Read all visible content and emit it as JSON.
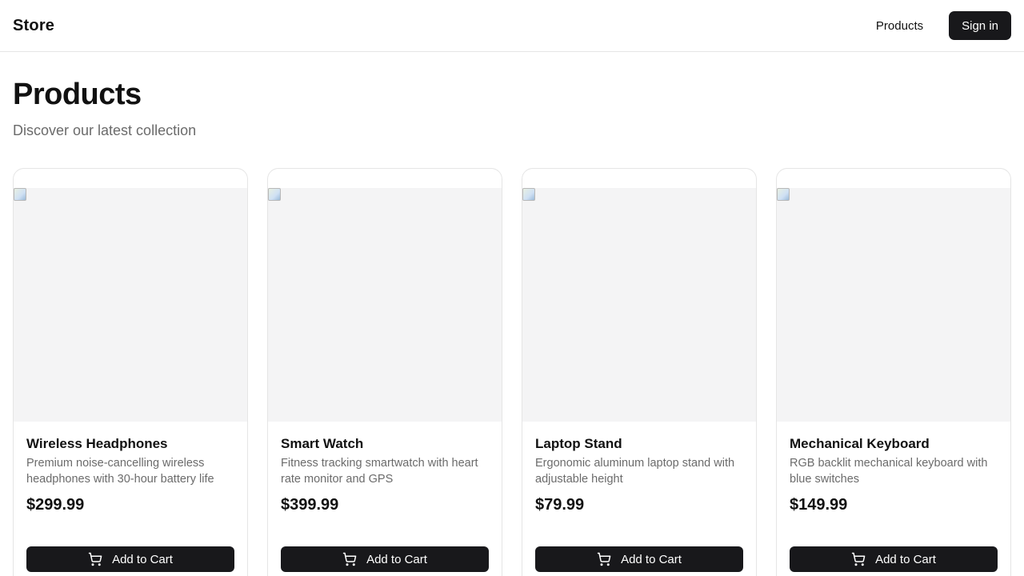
{
  "header": {
    "brand": "Store",
    "nav_products": "Products",
    "signin": "Sign in"
  },
  "page": {
    "title": "Products",
    "subtitle": "Discover our latest collection"
  },
  "products": [
    {
      "name": "Wireless Headphones",
      "description": "Premium noise-cancelling wireless headphones with 30-hour battery life",
      "price": "$299.99",
      "button": "Add to Cart",
      "icon": "cart-icon"
    },
    {
      "name": "Smart Watch",
      "description": "Fitness tracking smartwatch with heart rate monitor and GPS",
      "price": "$399.99",
      "button": "Add to Cart",
      "icon": "cart-icon"
    },
    {
      "name": "Laptop Stand",
      "description": "Ergonomic aluminum laptop stand with adjustable height",
      "price": "$79.99",
      "button": "Add to Cart",
      "icon": "cart-icon"
    },
    {
      "name": "Mechanical Keyboard",
      "description": "RGB backlit mechanical keyboard with blue switches",
      "price": "$149.99",
      "button": "Add to Cart",
      "icon": "cart-icon"
    }
  ],
  "colors": {
    "primary": "#18181b",
    "muted_text": "#6b6b6b",
    "image_placeholder": "#f4f4f5",
    "border": "#e5e5e5"
  }
}
